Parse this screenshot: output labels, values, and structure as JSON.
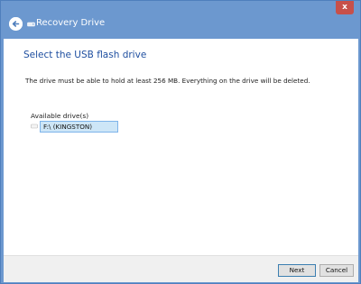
{
  "window": {
    "title": "Recovery Drive",
    "close_glyph": "x"
  },
  "page": {
    "heading": "Select the USB flash drive",
    "description": "The drive must be able to hold at least 256 MB. Everything on the drive will be deleted.",
    "available_label": "Available drive(s)",
    "drives": [
      {
        "label": "F:\\ (KINGSTON)",
        "selected": true
      }
    ]
  },
  "footer": {
    "next_label": "Next",
    "cancel_label": "Cancel"
  },
  "icons": {
    "back": "back-arrow-icon",
    "title_drive": "drive-icon",
    "close": "close-icon",
    "drive_item": "usb-drive-icon"
  },
  "colors": {
    "titlebar": "#6c98cf",
    "heading": "#1f4fa0",
    "close_button": "#c7504a",
    "selection_fill": "#cde6f7",
    "selection_border": "#7eb4ea"
  }
}
